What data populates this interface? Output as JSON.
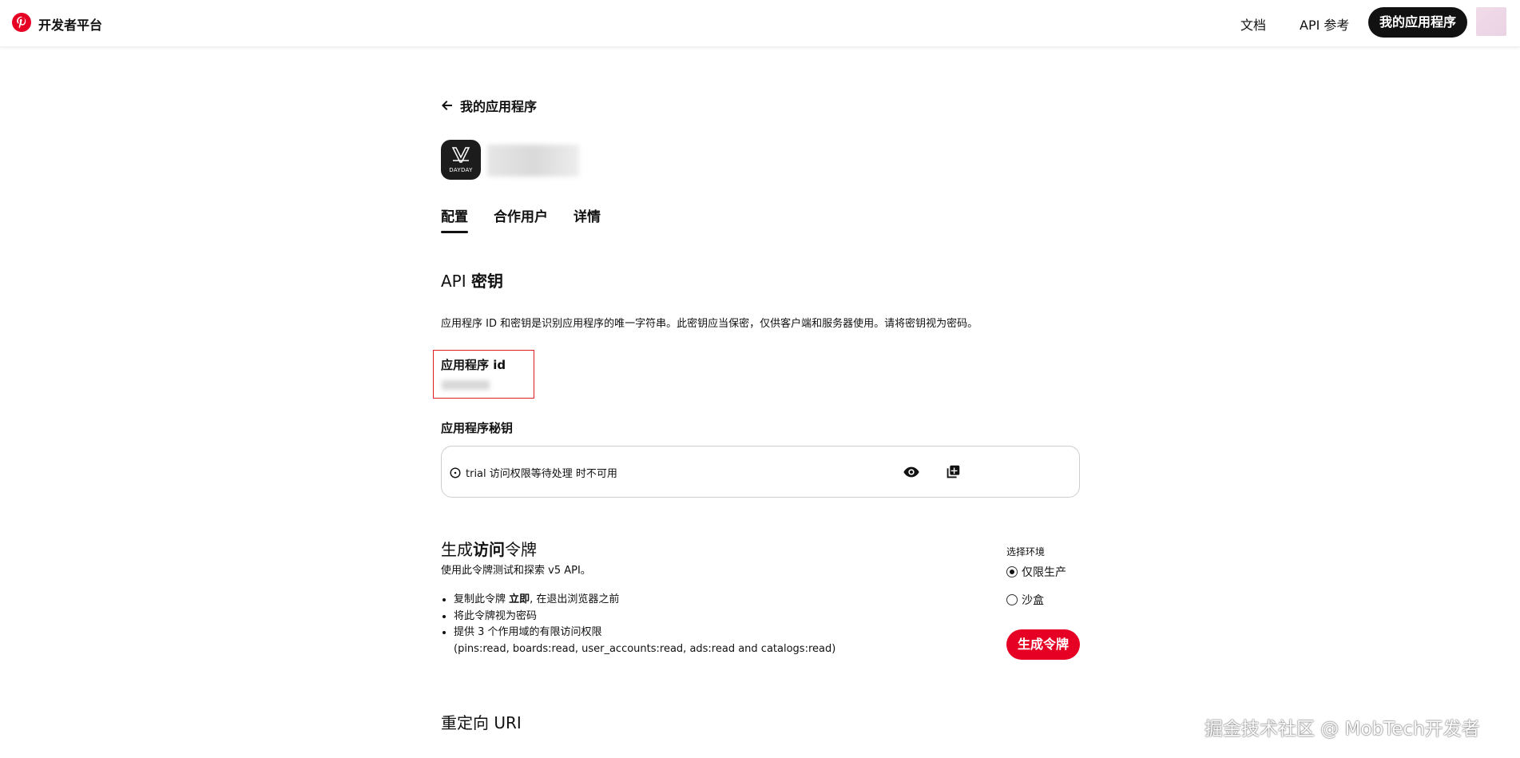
{
  "header": {
    "brand": "开发者平台",
    "nav": {
      "docs": "文档",
      "api_ref": "API 参考",
      "my_apps": "我的应用程序"
    },
    "brand_color": "#e60023"
  },
  "breadcrumb": {
    "back_label": "我的应用程序"
  },
  "app": {
    "icon_text": "DAYDAY"
  },
  "tabs": [
    {
      "label": "配置",
      "active": true
    },
    {
      "label": "合作用户",
      "active": false
    },
    {
      "label": "详情",
      "active": false
    }
  ],
  "api_keys": {
    "title_prefix": "API ",
    "title_bold": "密钥",
    "description": "应用程序 ID 和密钥是识别应用程序的唯一字符串。此密钥应当保密，仅供客户端和服务器使用。请将密钥视为密码。",
    "app_id_label": "应用程序 id",
    "secret_label": "应用程序秘钥",
    "secret_status": "trial 访问权限等待处理 时不可用"
  },
  "token": {
    "title_prefix": "生成",
    "title_bold": "访问",
    "title_suffix": "令牌",
    "subtitle": "使用此令牌测试和探索 v5 API。",
    "bullet1_prefix": "复制此令牌 ",
    "bullet1_bold": "立即",
    "bullet1_suffix": ", 在退出浏览器之前",
    "bullet2": "将此令牌视为密码",
    "bullet3": "提供 3 个作用域的有限访问权限",
    "scopes": "(pins:read, boards:read, user_accounts:read, ads:read and catalogs:read)",
    "env_label": "选择环境",
    "env_options": [
      {
        "label": "仅限生产",
        "checked": true
      },
      {
        "label": "沙盒",
        "checked": false
      }
    ],
    "generate_button": "生成令牌"
  },
  "redirect": {
    "title": "重定向 URI"
  },
  "watermark": "掘金技术社区 @ MobTech开发者"
}
